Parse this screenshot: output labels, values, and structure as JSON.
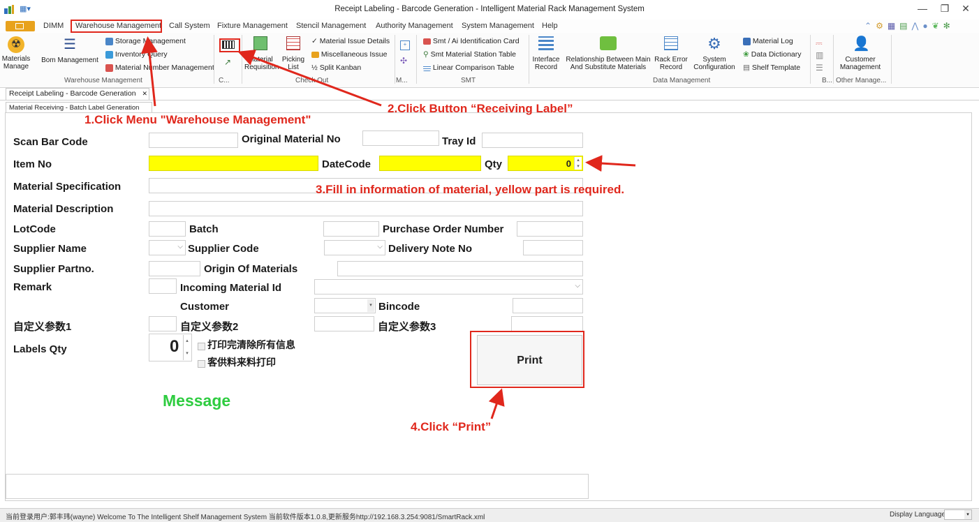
{
  "window": {
    "title": "Receipt Labeling - Barcode Generation - Intelligent Material Rack Management System",
    "minimize": "—",
    "maximize": "❐",
    "close": "✕"
  },
  "menu": [
    "DIMM",
    "Warehouse Management",
    "Call System",
    "Fixture Management",
    "Stencil Management",
    "Authority Management",
    "System Management",
    "Help"
  ],
  "ribbon": {
    "materials_manage": "Materials\nManage",
    "bom_management": "Bom Management",
    "storage_management": "Storage Management",
    "inventory_query": "Inventory Query",
    "material_number_management": "Material Number Management",
    "material_requisition": "Material\nRequisition",
    "picking_list": "Picking\nList",
    "material_issue_details": "Material Issue Details",
    "miscellaneous_issue": "Miscellaneous Issue",
    "split_kanban": "Split Kanban",
    "smt_ai_card": "Smt / Ai Identification Card",
    "smt_station_table": "Smt Material Station Table",
    "linear_comparison_table": "Linear Comparison Table",
    "interface_record": "Interface\nRecord",
    "relationship": "Relationship Between Main\nAnd Substitute Materials",
    "rack_error_record": "Rack Error\nRecord",
    "system_configuration": "System\nConfiguration",
    "material_log": "Material Log",
    "data_dictionary": "Data Dictionary",
    "shelf_template": "Shelf Template",
    "customer_management": "Customer\nManagement",
    "groups": {
      "warehouse_management": "Warehouse Management",
      "c": "C...",
      "check_out": "Check Out",
      "m": "M...",
      "smt": "SMT",
      "data_management": "Data Management",
      "b": "B...",
      "other_manage": "Other Manage..."
    }
  },
  "tabs": {
    "doc_tab": "Receipt Labeling - Barcode Generation",
    "doc_tab_close": "✕",
    "sub_tab": "Material Receiving - Batch Label Generation"
  },
  "form": {
    "scan_bar_code": "Scan Bar Code",
    "original_material_no": "Original Material No",
    "tray_id": "Tray Id",
    "item_no": "Item No",
    "datecode": "DateCode",
    "qty": "Qty",
    "qty_value": "0",
    "material_specification": "Material Specification",
    "material_description": "Material Description",
    "lotcode": "LotCode",
    "batch": "Batch",
    "purchase_order_number": "Purchase Order Number",
    "supplier_name": "Supplier Name",
    "supplier_code": "Supplier Code",
    "delivery_note_no": "Delivery Note No",
    "supplier_partno": "Supplier Partno.",
    "origin_of_materials": "Origin Of Materials",
    "remark": "Remark",
    "incoming_material_id": "Incoming Material Id",
    "customer": "Customer",
    "bincode": "Bincode",
    "custom1": "自定义参数1",
    "custom2": "自定义参数2",
    "custom3": "自定义参数3",
    "labels_qty": "Labels Qty",
    "labels_qty_value": "0",
    "clear_after_print": "打印完清除所有信息",
    "consignment_print": "客供料来料打印",
    "print": "Print",
    "message": "Message"
  },
  "annotations": {
    "step1": "1.Click Menu \"Warehouse Management\"",
    "step2": "2.Click Button  “Receiving Label”",
    "step3": "3.Fill in information of material, yellow part is required.",
    "step4": "4.Click  “Print”"
  },
  "status": {
    "text": "当前登录用户:郭丰玮(wayne)  Welcome To The Intelligent Shelf Management System  当前软件版本1.0.8,更新服务http://192.168.3.254:9081/SmartRack.xml",
    "display_language": "Display Language"
  },
  "colors": {
    "annotation_red": "#e0271c",
    "required_yellow": "#ffff00",
    "message_green": "#2ecc40"
  }
}
